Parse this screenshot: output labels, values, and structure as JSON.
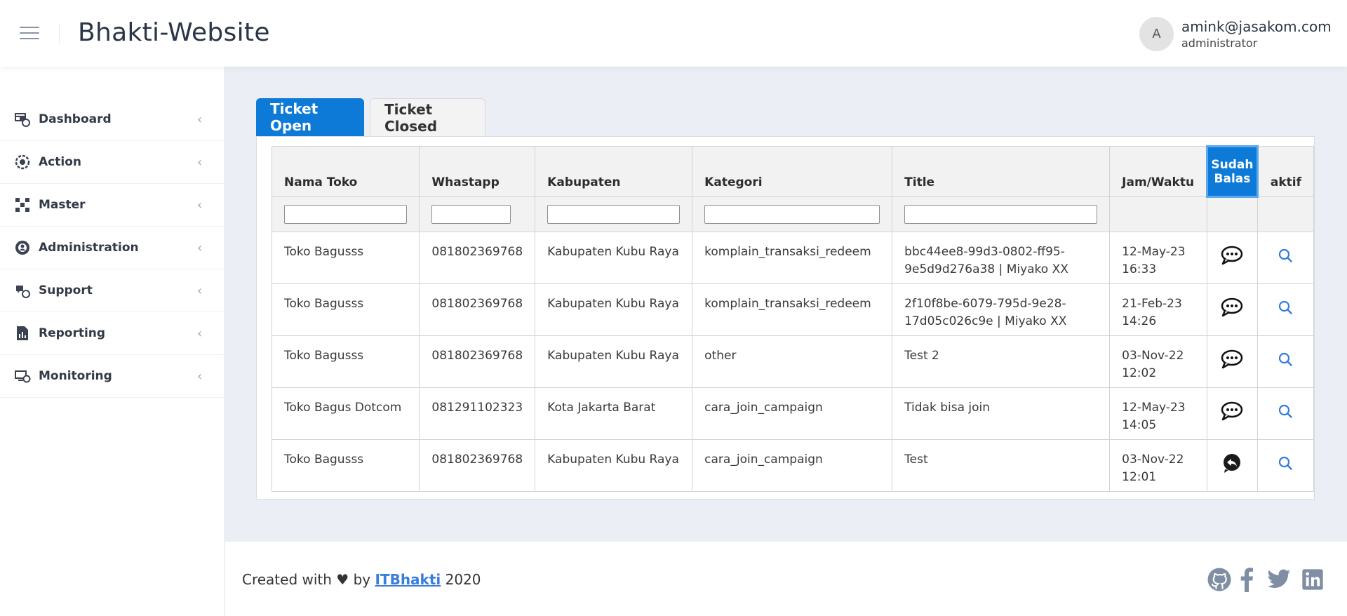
{
  "app": {
    "title": "Bhakti-Website"
  },
  "user": {
    "avatar_letter": "A",
    "email": "amink@jasakom.com",
    "role": "administrator"
  },
  "sidebar": {
    "items": [
      {
        "label": "Dashboard",
        "icon": "dashboard-icon"
      },
      {
        "label": "Action",
        "icon": "action-icon"
      },
      {
        "label": "Master",
        "icon": "master-icon"
      },
      {
        "label": "Administration",
        "icon": "administration-icon"
      },
      {
        "label": "Support",
        "icon": "support-icon"
      },
      {
        "label": "Reporting",
        "icon": "reporting-icon"
      },
      {
        "label": "Monitoring",
        "icon": "monitoring-icon"
      }
    ]
  },
  "tabs": [
    {
      "label": "Ticket Open",
      "active": true
    },
    {
      "label": "Ticket Closed",
      "active": false
    }
  ],
  "table": {
    "columns": [
      "Nama Toko",
      "Whastapp",
      "Kabupaten",
      "Kategori",
      "Title",
      "Jam/Waktu",
      "Sudah Balas",
      "aktif"
    ],
    "rows": [
      {
        "nama_toko": "Toko Bagusss",
        "whatsapp": "081802369768",
        "kabupaten": "Kabupaten Kubu Raya",
        "kategori": "komplain_transaksi_redeem",
        "title": "bbc44ee8-99d3-0802-ff95-9e5d9d276a38 | Miyako XX",
        "waktu": "12-May-23 16:33",
        "reply_icon": "chat-icon"
      },
      {
        "nama_toko": "Toko Bagusss",
        "whatsapp": "081802369768",
        "kabupaten": "Kabupaten Kubu Raya",
        "kategori": "komplain_transaksi_redeem",
        "title": "2f10f8be-6079-795d-9e28-17d05c026c9e | Miyako XX",
        "waktu": "21-Feb-23 14:26",
        "reply_icon": "chat-icon"
      },
      {
        "nama_toko": "Toko Bagusss",
        "whatsapp": "081802369768",
        "kabupaten": "Kabupaten Kubu Raya",
        "kategori": "other",
        "title": "Test 2",
        "waktu": "03-Nov-22 12:02",
        "reply_icon": "chat-icon"
      },
      {
        "nama_toko": "Toko Bagus Dotcom",
        "whatsapp": "081291102323",
        "kabupaten": "Kota Jakarta Barat",
        "kategori": "cara_join_campaign",
        "title": "Tidak bisa join",
        "waktu": "12-May-23 14:05",
        "reply_icon": "chat-icon"
      },
      {
        "nama_toko": "Toko Bagusss",
        "whatsapp": "081802369768",
        "kabupaten": "Kabupaten Kubu Raya",
        "kategori": "cara_join_campaign",
        "title": "Test",
        "waktu": "03-Nov-22 12:01",
        "reply_icon": "reply-icon"
      }
    ]
  },
  "footer": {
    "prefix": "Created with ♥ by ",
    "link": "ITBhakti",
    "suffix": " 2020",
    "social": [
      "github-icon",
      "facebook-icon",
      "twitter-icon",
      "linkedin-icon"
    ]
  },
  "colors": {
    "accent": "#0d7ad8",
    "footer_link": "#3b7ddd",
    "background": "#ebeef5"
  }
}
